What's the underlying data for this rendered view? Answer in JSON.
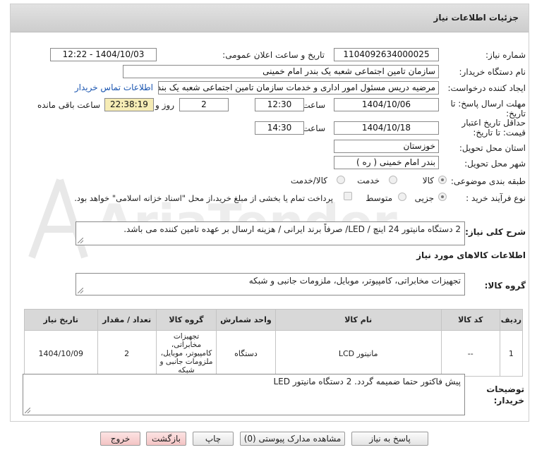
{
  "header": {
    "title": "جزئیات اطلاعات نیاز"
  },
  "fields": {
    "need_number_label": "شماره نیاز:",
    "need_number": "1104092634000025",
    "announce_label": "تاریخ و ساعت اعلان عمومی:",
    "announce_value": "1404/10/03 - 12:22",
    "buyer_label": "نام دستگاه خریدار:",
    "buyer_value": "سازمان تامین اجتماعی شعبه یک بندر امام خمینی",
    "creator_label": "ایجاد کننده درخواست:",
    "creator_value": "مرضیه دریس مسئول امور اداری و خدمات سازمان تامین اجتماعی شعبه یک بندر",
    "contact_link": "اطلاعات تماس خریدار",
    "deadline_label_1": "مهلت ارسال پاسخ: تا",
    "deadline_label_2": "تاریخ:",
    "deadline_date": "1404/10/06",
    "time_label": "ساعت",
    "deadline_time": "12:30",
    "days_value": "2",
    "days_label": "روز و",
    "remaining_time": "22:38:19",
    "remaining_label": "ساعت باقی مانده",
    "validity_label_1": "حداقل تاریخ اعتبار",
    "validity_label_2": "قیمت: تا تاریخ:",
    "validity_date": "1404/10/18",
    "validity_time_label": "ساعت",
    "validity_time": "14:30",
    "province_label": "استان محل تحویل:",
    "province_value": "خوزستان",
    "city_label": "شهر محل تحویل:",
    "city_value": "بندر امام خمینی ( ره )",
    "category_label": "طبقه بندی موضوعی:",
    "category_options": [
      "کالا",
      "خدمت",
      "کالا/خدمت"
    ],
    "process_label": "نوع فرآیند خرید :",
    "process_options": [
      "جزیی",
      "متوسط"
    ],
    "payment_note": "پرداخت تمام یا بخشی از مبلغ خرید،از محل \"اسناد خزانه اسلامی\" خواهد بود."
  },
  "description": {
    "label": "شرح کلی نیاز:",
    "text": "2 دستگاه مانیتور 24 اینچ / LED/ صرفاً برند ایرانی / هزینه ارسال بر عهده تامین کننده می باشد."
  },
  "goods_section": {
    "title": "اطلاعات کالاهای مورد نیاز",
    "group_label": "گروه کالا:",
    "group_value": "تجهیزات مخابراتی، کامپیوتر، موبایل، ملزومات جانبی و شبکه"
  },
  "table": {
    "headers": [
      "ردیف",
      "کد کالا",
      "نام کالا",
      "واحد شمارش",
      "گروه کالا",
      "تعداد / مقدار",
      "تاریخ نیاز"
    ],
    "rows": [
      [
        "1",
        "--",
        "مانیتور LCD",
        "دستگاه",
        "تجهیزات مخابراتی، کامپیوتر، موبایل، ملزومات جانبی و شبکه",
        "2",
        "1404/10/09"
      ]
    ]
  },
  "notes": {
    "label_1": "توضیحات",
    "label_2": "خریدار:",
    "text": "پیش فاکتور حتما ضمیمه گردد. 2 دستگاه مانیتور LED"
  },
  "buttons": {
    "reply": "پاسخ به نیاز",
    "attachments": "مشاهده مدارک پیوستی (0)",
    "print": "چاپ",
    "back": "بازگشت",
    "exit": "خروج"
  },
  "watermark_text": "AriaTender.neT",
  "colors": {
    "link": "#1a55b0",
    "highlight": "#f6ecb5",
    "header": "#d3d3d3"
  }
}
